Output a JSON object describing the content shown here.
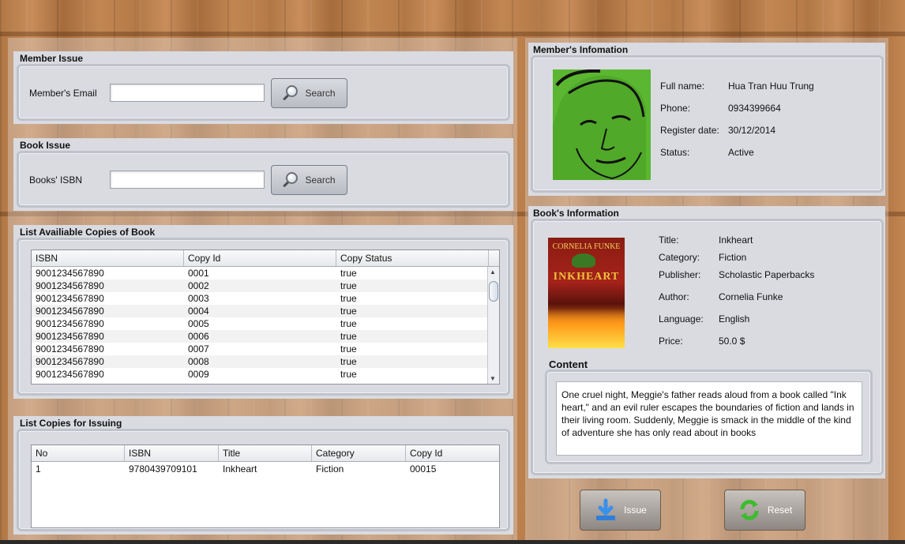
{
  "member_issue": {
    "title": "Member Issue",
    "email_label": "Member's Email",
    "email_value": "",
    "search_label": "Search"
  },
  "book_issue": {
    "title": "Book Issue",
    "isbn_label": "Books' ISBN",
    "isbn_value": "",
    "search_label": "Search"
  },
  "available_copies": {
    "title": "List Availiable Copies of Book",
    "columns": [
      "ISBN",
      "Copy Id",
      "Copy Status"
    ],
    "rows": [
      [
        "9001234567890",
        "0001",
        "true"
      ],
      [
        "9001234567890",
        "0002",
        "true"
      ],
      [
        "9001234567890",
        "0003",
        "true"
      ],
      [
        "9001234567890",
        "0004",
        "true"
      ],
      [
        "9001234567890",
        "0005",
        "true"
      ],
      [
        "9001234567890",
        "0006",
        "true"
      ],
      [
        "9001234567890",
        "0007",
        "true"
      ],
      [
        "9001234567890",
        "0008",
        "true"
      ],
      [
        "9001234567890",
        "0009",
        "true"
      ]
    ]
  },
  "issuing_copies": {
    "title": "List Copies for Issuing",
    "columns": [
      "No",
      "ISBN",
      "Title",
      "Category",
      "Copy Id"
    ],
    "rows": [
      [
        "1",
        "9780439709101",
        "Inkheart",
        "Fiction",
        "00015"
      ]
    ]
  },
  "member_info": {
    "title": "Member's Infomation",
    "fields": [
      {
        "key": "Full name:",
        "value": "Hua Tran Huu Trung"
      },
      {
        "key": "Phone:",
        "value": "0934399664"
      },
      {
        "key": "Register date:",
        "value": "30/12/2014"
      },
      {
        "key": "Status:",
        "value": "Active"
      }
    ]
  },
  "book_info": {
    "title": "Book's Information",
    "cover": {
      "author_line": "CORNELIA FUNKE",
      "title_line": "INKHEART"
    },
    "fields": [
      {
        "key": "Title:",
        "value": "Inkheart"
      },
      {
        "key": "Category:",
        "value": "Fiction"
      },
      {
        "key": "Publisher:",
        "value": "Scholastic Paperbacks"
      },
      {
        "key": "Author:",
        "value": "Cornelia Funke"
      },
      {
        "key": "Language:",
        "value": "English"
      },
      {
        "key": "Price:",
        "value": "50.0 $"
      }
    ],
    "content_label": "Content",
    "content_text": "One cruel night, Meggie's father reads aloud from a book called \"Ink heart,\" and an evil ruler escapes the boundaries of fiction and lands in their living room. Suddenly, Meggie is smack in the middle of the kind of adventure she has only read about in books"
  },
  "actions": {
    "issue_label": "Issue",
    "reset_label": "Reset"
  },
  "icons": {
    "search": "magnifier-icon",
    "issue": "download-arrow-icon",
    "reset": "refresh-icon"
  },
  "colors": {
    "panel": "#d9dbe1",
    "wood": "#b97e4b",
    "avatar_green": "#58b52e"
  }
}
